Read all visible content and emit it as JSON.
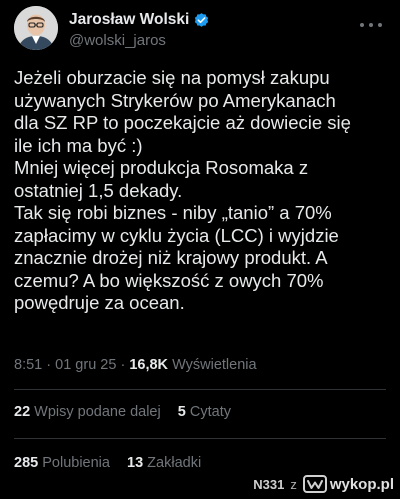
{
  "author": {
    "name": "Jarosław Wolski",
    "handle": "@wolski_jaros",
    "verified_color": "#1d9bf0"
  },
  "tweet": {
    "text": "Jeżeli oburzacie się na pomysł zakupu\nużywanych Strykerów po Amerykanach\ndla SZ RP to poczekajcie aż dowiecie się\nile  ich ma być :)\nMniej więcej produkcja Rosomaka z\nostatniej 1,5 dekady.\nTak się robi biznes - niby „tanio” a 70%\nzapłacimy w cyklu życia (LCC) i wyjdzie\nznacznie drożej niż krajowy produkt. A\nczemu? A bo większość z owych 70%\npowędruje za ocean."
  },
  "meta": {
    "time": "8:51",
    "sep1": "·",
    "date": "01 gru 25",
    "sep2": "·",
    "views_count": "16,8K",
    "views_label": "Wyświetlenia"
  },
  "stats_row1": {
    "reposts_count": "22",
    "reposts_label": "Wpisy podane dalej",
    "quotes_count": "5",
    "quotes_label": "Cytaty"
  },
  "stats_row2": {
    "likes_count": "285",
    "likes_label": "Polubienia",
    "bookmarks_count": "13",
    "bookmarks_label": "Zakładki"
  },
  "footer": {
    "user": "N331",
    "connector": "z",
    "brand": "wykop.pl"
  },
  "colors": {
    "background": "#000000",
    "text": "#e7e9ea",
    "muted": "#71767b",
    "divider": "#2f3336"
  },
  "icons": [
    "avatar",
    "verified-badge-icon",
    "more-options-icon",
    "wykop-logo-icon"
  ]
}
